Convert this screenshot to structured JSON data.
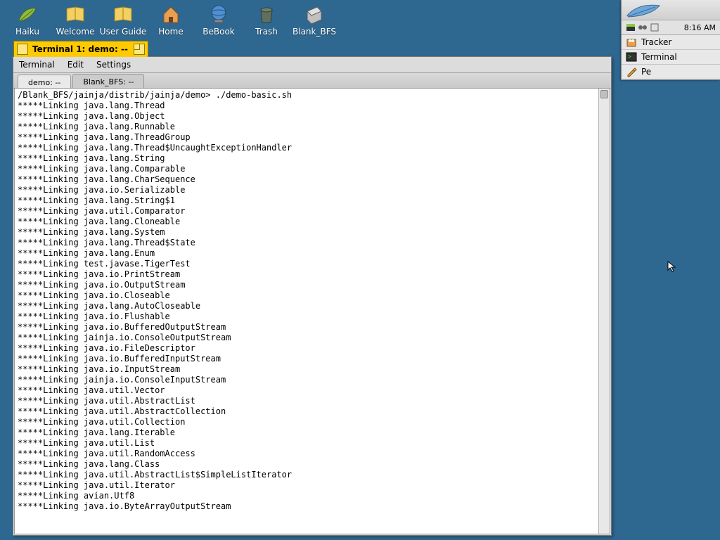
{
  "desktop": {
    "icons": [
      {
        "name": "haiku",
        "label": "Haiku"
      },
      {
        "name": "welcome",
        "label": "Welcome"
      },
      {
        "name": "userguide",
        "label": "User Guide"
      },
      {
        "name": "home",
        "label": "Home"
      },
      {
        "name": "bebook",
        "label": "BeBook"
      },
      {
        "name": "trash",
        "label": "Trash"
      },
      {
        "name": "blankbfs",
        "label": "Blank_BFS"
      }
    ]
  },
  "deskbar": {
    "clock": "8:16 AM",
    "apps": [
      {
        "name": "tracker",
        "label": "Tracker"
      },
      {
        "name": "terminal",
        "label": "Terminal"
      },
      {
        "name": "pe",
        "label": "Pe"
      }
    ]
  },
  "window": {
    "title": "Terminal 1: demo: --",
    "menus": [
      "Terminal",
      "Edit",
      "Settings"
    ],
    "tabs": [
      {
        "label": "demo: --",
        "active": true
      },
      {
        "label": "Blank_BFS: --",
        "active": false
      }
    ],
    "prompt": "/Blank_BFS/jainja/distrib/jainja/demo> ./demo-basic.sh",
    "lines": [
      "*****Linking java.lang.Thread",
      "*****Linking java.lang.Object",
      "*****Linking java.lang.Runnable",
      "*****Linking java.lang.ThreadGroup",
      "*****Linking java.lang.Thread$UncaughtExceptionHandler",
      "*****Linking java.lang.String",
      "*****Linking java.lang.Comparable",
      "*****Linking java.lang.CharSequence",
      "*****Linking java.io.Serializable",
      "*****Linking java.lang.String$1",
      "*****Linking java.util.Comparator",
      "*****Linking java.lang.Cloneable",
      "*****Linking java.lang.System",
      "*****Linking java.lang.Thread$State",
      "*****Linking java.lang.Enum",
      "*****Linking test.javase.TigerTest",
      "*****Linking java.io.PrintStream",
      "*****Linking java.io.OutputStream",
      "*****Linking java.io.Closeable",
      "*****Linking java.lang.AutoCloseable",
      "*****Linking java.io.Flushable",
      "*****Linking java.io.BufferedOutputStream",
      "*****Linking jainja.io.ConsoleOutputStream",
      "*****Linking java.io.FileDescriptor",
      "*****Linking java.io.BufferedInputStream",
      "*****Linking java.io.InputStream",
      "*****Linking jainja.io.ConsoleInputStream",
      "*****Linking java.util.Vector",
      "*****Linking java.util.AbstractList",
      "*****Linking java.util.AbstractCollection",
      "*****Linking java.util.Collection",
      "*****Linking java.lang.Iterable",
      "*****Linking java.util.List",
      "*****Linking java.util.RandomAccess",
      "*****Linking java.lang.Class",
      "*****Linking java.util.AbstractList$SimpleListIterator",
      "*****Linking java.util.Iterator",
      "*****Linking avian.Utf8",
      "*****Linking java.io.ByteArrayOutputStream"
    ]
  }
}
